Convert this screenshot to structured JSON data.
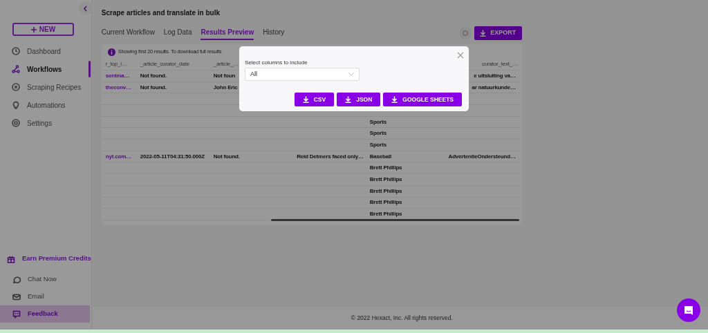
{
  "page_title": "Scrape articles and translate in bulk",
  "sidebar": {
    "new_button": "NEW",
    "items": [
      {
        "label": "Dashboard",
        "selected": false
      },
      {
        "label": "Workflows",
        "selected": true
      },
      {
        "label": "Scraping Recipes",
        "selected": false
      },
      {
        "label": "Automations",
        "selected": false
      },
      {
        "label": "Settings",
        "selected": false
      }
    ],
    "bottom_items": [
      {
        "label": "Earn Premium Credits",
        "kind": "promo"
      },
      {
        "label": "Chat Now",
        "kind": "plain"
      },
      {
        "label": "Email",
        "kind": "plain"
      },
      {
        "label": "Feedback",
        "kind": "highlight"
      }
    ]
  },
  "tabs": [
    {
      "label": "Current Workflow",
      "selected": false
    },
    {
      "label": "Log Data",
      "selected": false
    },
    {
      "label": "Results Preview",
      "selected": true
    },
    {
      "label": "History",
      "selected": false
    }
  ],
  "export_button": "EXPORT",
  "info": "Showing first 20 results. To download full results",
  "table": {
    "columns": [
      "r_top_i…",
      "_article_curator_date",
      "_article_…",
      "",
      "",
      "curator_text_…"
    ],
    "rows": [
      [
        "sentma…",
        "Not found.",
        "Not foun",
        "",
        "",
        "e uitsluiting va…"
      ],
      [
        "theconv…",
        "Not found.",
        "John Eric",
        "",
        "",
        "ar natuurkunde…"
      ],
      [
        "",
        "",
        "",
        "",
        "",
        ""
      ],
      [
        "",
        "",
        "",
        "",
        "",
        ""
      ],
      [
        "",
        "",
        "",
        "",
        "Sports",
        ""
      ],
      [
        "",
        "",
        "",
        "",
        "Sports",
        ""
      ],
      [
        "",
        "",
        "",
        "",
        "Sports",
        ""
      ],
      [
        "nyt.com…",
        "2022-05-11T04:31:50.000Z",
        "Not found.",
        "Reid Detmers faced only…",
        "Baseball",
        "AdvertentieOndersteund…"
      ],
      [
        "",
        "",
        "",
        "",
        "Brett Phillips",
        ""
      ],
      [
        "",
        "",
        "",
        "",
        "Brett Phillips",
        ""
      ],
      [
        "",
        "",
        "",
        "",
        "Brett Phillips",
        ""
      ],
      [
        "",
        "",
        "",
        "",
        "Brett Phillips",
        ""
      ],
      [
        "",
        "",
        "",
        "",
        "Brett Phillips",
        ""
      ]
    ]
  },
  "footer": "© 2022 Hexact, Inc. All rights reserved.",
  "modal": {
    "label": "Select columns to include",
    "value": "All",
    "buttons": [
      "CSV",
      "JSON",
      "GOOGLE SHEETS"
    ]
  }
}
